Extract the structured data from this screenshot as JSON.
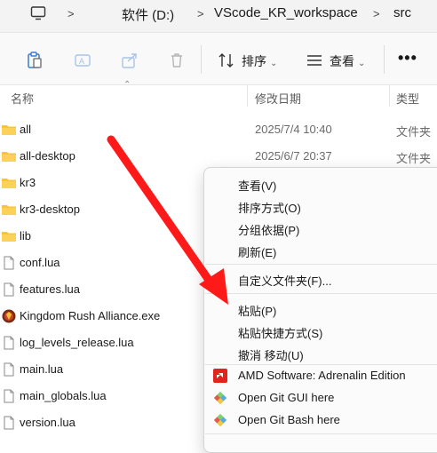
{
  "address_bar": {
    "crumbs": [
      "软件 (D:)",
      "VScode_KR_workspace",
      "src"
    ],
    "separator": ">"
  },
  "toolbar": {
    "sort_label": "排序",
    "view_label": "查看",
    "more_label": "•••"
  },
  "columns": {
    "name": "名称",
    "date": "修改日期",
    "type": "类型"
  },
  "files": [
    {
      "name": "all",
      "date": "2025/7/4 10:40",
      "type": "文件夹",
      "icon": "folder-icon"
    },
    {
      "name": "all-desktop",
      "date": "2025/6/7 20:37",
      "type": "文件夹",
      "icon": "folder-icon"
    },
    {
      "name": "kr3",
      "date": "",
      "type": "",
      "icon": "folder-icon"
    },
    {
      "name": "kr3-desktop",
      "date": "",
      "type": "",
      "icon": "folder-icon"
    },
    {
      "name": "lib",
      "date": "",
      "type": "",
      "icon": "folder-icon"
    },
    {
      "name": "conf.lua",
      "date": "",
      "type": "",
      "icon": "file-icon"
    },
    {
      "name": "features.lua",
      "date": "",
      "type": "",
      "icon": "file-icon"
    },
    {
      "name": "Kingdom Rush Alliance.exe",
      "date": "",
      "type": "",
      "icon": "exe-icon"
    },
    {
      "name": "log_levels_release.lua",
      "date": "",
      "type": "",
      "icon": "file-icon"
    },
    {
      "name": "main.lua",
      "date": "",
      "type": "",
      "icon": "file-icon"
    },
    {
      "name": "main_globals.lua",
      "date": "",
      "type": "",
      "icon": "file-icon"
    },
    {
      "name": "version.lua",
      "date": "",
      "type": "",
      "icon": "file-icon"
    }
  ],
  "context_menu": {
    "view": "查看(V)",
    "sort_by": "排序方式(O)",
    "group_by": "分组依据(P)",
    "refresh": "刷新(E)",
    "customize": "自定义文件夹(F)...",
    "paste": "粘贴(P)",
    "paste_shortcut": "粘贴快捷方式(S)",
    "undo_move": "撤消 移动(U)",
    "amd": "AMD Software: Adrenalin Edition",
    "git_gui": "Open Git GUI here",
    "git_bash": "Open Git Bash here"
  },
  "colors": {
    "folder": "#f8c43a",
    "amd_red": "#e1251b",
    "arrow_red": "#ff1a1a",
    "git_green": "#7bd36b",
    "git_blue": "#56a8e6"
  }
}
